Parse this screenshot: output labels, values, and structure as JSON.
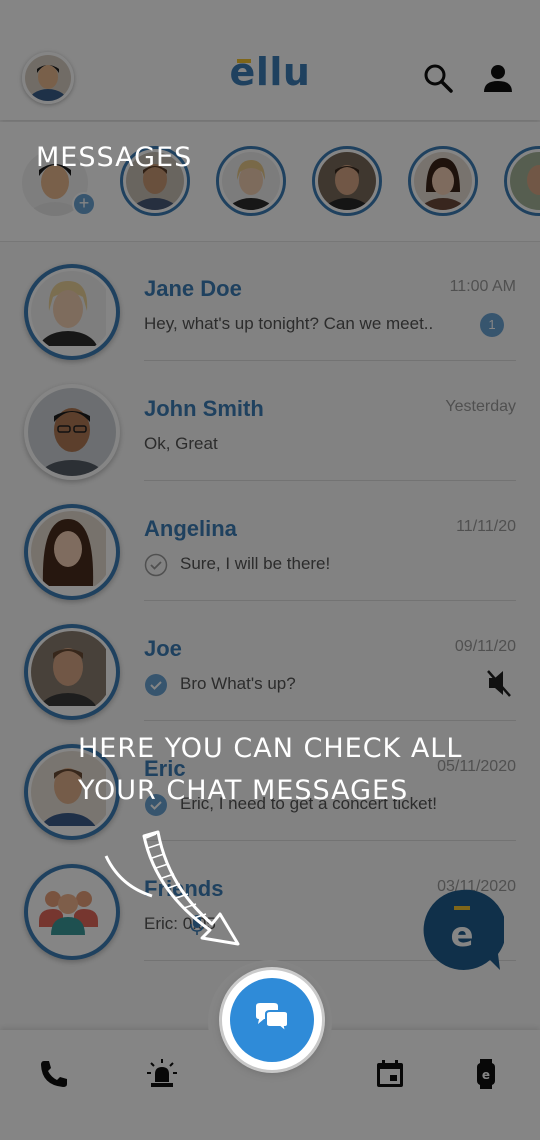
{
  "header": {
    "logo": "ellu",
    "search_icon": "search-icon",
    "profile_icon": "person-icon"
  },
  "stories": [
    {
      "name": "me-add",
      "badge": "+"
    },
    {
      "name": "story-1"
    },
    {
      "name": "story-2"
    },
    {
      "name": "story-3"
    },
    {
      "name": "story-4"
    },
    {
      "name": "story-5"
    }
  ],
  "chats": [
    {
      "name": "Jane Doe",
      "time": "11:00 AM",
      "message": "Hey, what's up tonight? Can we meet..",
      "unread": "1"
    },
    {
      "name": "John Smith",
      "time": "Yesterday",
      "message": "Ok, Great"
    },
    {
      "name": "Angelina",
      "time": "11/11/20",
      "message": "Sure, I will be there!"
    },
    {
      "name": "Joe",
      "time": "09/11/20",
      "message": "Bro What's up?",
      "muted": "mute-icon"
    },
    {
      "name": "Eric",
      "time": "05/11/2020",
      "message": "Eric, I need to get a concert ticket!"
    },
    {
      "name": "Friends",
      "time": "03/11/2020",
      "message": "Eric:  0:05"
    }
  ],
  "tutorial": {
    "title": "MESSAGES",
    "hint": "HERE YOU CAN CHECK ALL YOUR CHAT MESSAGES"
  },
  "nav": {
    "items": [
      "phone-icon",
      "alarm-light-icon",
      "chat-icon",
      "calendar-icon",
      "watch-icon"
    ]
  },
  "colors": {
    "brand_blue": "#3d7eb6",
    "accent_yellow": "#f4c430",
    "fab_blue": "#1f5d8e"
  }
}
